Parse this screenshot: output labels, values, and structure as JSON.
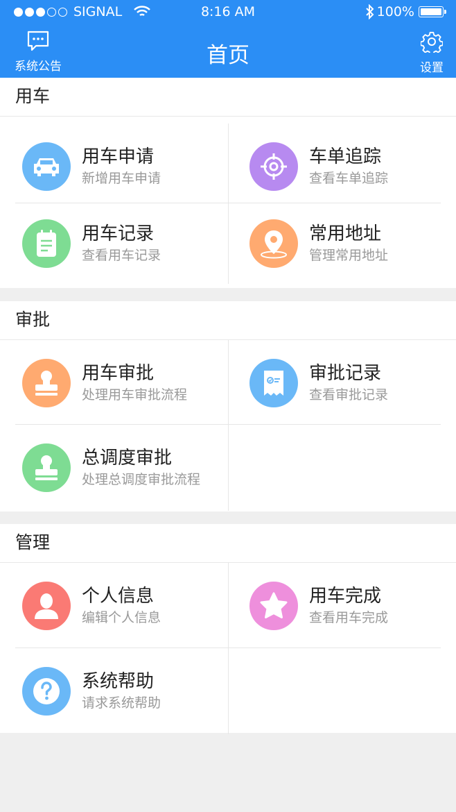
{
  "status": {
    "carrier": "SIGNAL",
    "time": "8:16 AM",
    "battery": "100%"
  },
  "nav": {
    "left_label": "系统公告",
    "title": "首页",
    "right_label": "设置"
  },
  "sections": [
    {
      "title": "用车",
      "items": [
        {
          "title": "用车申请",
          "sub": "新增用车申请",
          "icon": "car-icon",
          "color": "#6ab8f7"
        },
        {
          "title": "车单追踪",
          "sub": "查看车单追踪",
          "icon": "target-icon",
          "color": "#b78af0"
        },
        {
          "title": "用车记录",
          "sub": "查看用车记录",
          "icon": "clipboard-icon",
          "color": "#7edc93"
        },
        {
          "title": "常用地址",
          "sub": "管理常用地址",
          "icon": "location-pin-icon",
          "color": "#ffaa70"
        }
      ]
    },
    {
      "title": "审批",
      "items": [
        {
          "title": "用车审批",
          "sub": "处理用车审批流程",
          "icon": "stamp-icon",
          "color": "#ffaa70"
        },
        {
          "title": "审批记录",
          "sub": "查看审批记录",
          "icon": "receipt-icon",
          "color": "#6ab8f7"
        },
        {
          "title": "总调度审批",
          "sub": "处理总调度审批流程",
          "icon": "stamp-icon",
          "color": "#7edc93"
        }
      ]
    },
    {
      "title": "管理",
      "items": [
        {
          "title": "个人信息",
          "sub": "编辑个人信息",
          "icon": "user-icon",
          "color": "#fa7a74"
        },
        {
          "title": "用车完成",
          "sub": "查看用车完成",
          "icon": "star-icon",
          "color": "#ee8fdc"
        },
        {
          "title": "系统帮助",
          "sub": "请求系统帮助",
          "icon": "help-icon",
          "color": "#6ab8f7"
        }
      ]
    }
  ]
}
